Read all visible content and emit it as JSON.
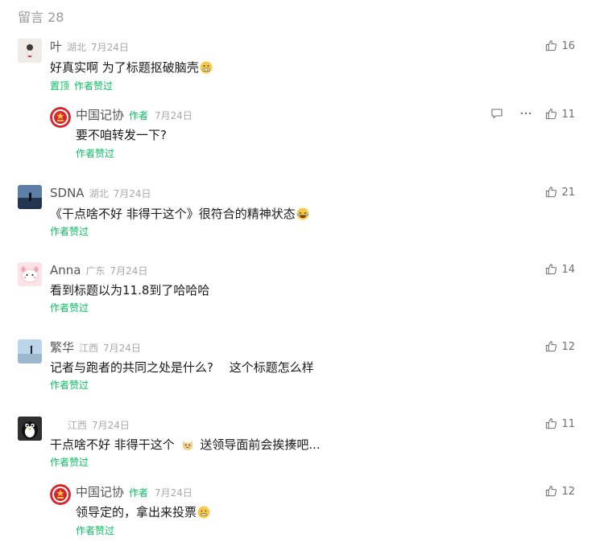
{
  "header": {
    "title": "留言 28"
  },
  "comments": [
    {
      "name": "叶",
      "region": "湖北",
      "date": "7月24日",
      "text": "好真实啊 为了标题抠破脑壳",
      "emoji": "grimace-emoji",
      "pinned": "置顶",
      "liked_by_author": "作者赞过",
      "likes": "16"
    },
    {
      "name": "中国记协",
      "author_tag": "作者",
      "date": "7月24日",
      "text": "要不咱转发一下?",
      "liked_by_author": "作者赞过",
      "likes": "11",
      "is_reply": true
    },
    {
      "name": "SDNA",
      "region": "湖北",
      "date": "7月24日",
      "text": "《干点啥不好 非得干这个》很符合的精神状态",
      "emoji": "laugh-cry-emoji",
      "liked_by_author": "作者赞过",
      "likes": "21"
    },
    {
      "name": "Anna",
      "region": "广东",
      "date": "7月24日",
      "text": "看到标题以为11.8到了哈哈哈",
      "liked_by_author": "作者赞过",
      "likes": "14"
    },
    {
      "name": "繁华",
      "region": "江西",
      "date": "7月24日",
      "text": "记者与跑者的共同之处是什么?　 这个标题怎么样",
      "liked_by_author": "作者赞过",
      "likes": "12"
    },
    {
      "name": "",
      "region": "江西",
      "date": "7月24日",
      "text_before": "干点啥不好 非得干这个",
      "emoji": "cat-face-emoji",
      "text_after": "送领导面前会挨揍吧...",
      "liked_by_author": "作者赞过",
      "likes": "11"
    },
    {
      "name": "中国记协",
      "author_tag": "作者",
      "date": "7月24日",
      "text": "领导定的，拿出来投票",
      "emoji": "awkward-smile-emoji",
      "liked_by_author": "作者赞过",
      "likes": "12",
      "is_reply": true
    }
  ],
  "icons": {
    "like": "thumbs-up-icon",
    "reply": "comment-bubble-icon",
    "more": "more-dots-icon"
  },
  "colors": {
    "accent": "#07c160",
    "muted": "#a8a8a8",
    "text": "#1a1a1a"
  }
}
